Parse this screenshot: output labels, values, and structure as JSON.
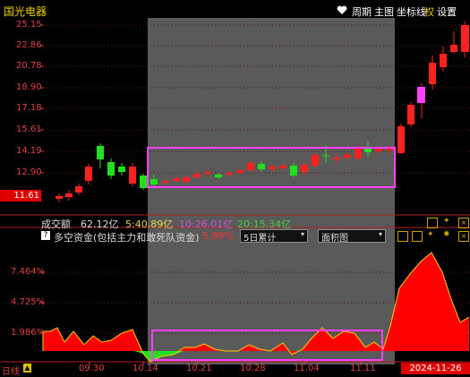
{
  "stock": {
    "name": "国光电器",
    "last_price": "11.61"
  },
  "toolbar": {
    "period": "周期",
    "main": "主图",
    "indicator": "坐标线",
    "quan": "权",
    "settings": "设置"
  },
  "price_axis": [
    "25.15",
    "22.86",
    "20.78",
    "18.90",
    "17.18",
    "15.61",
    "14.19",
    "12.90"
  ],
  "volume_bar": {
    "label": "成交额",
    "value": "62.12亿",
    "ma5": "5:40.89亿",
    "ma10": "10:26.01亿",
    "ma20": "20:15.34亿",
    "colors": {
      "ma5": "#e8d24a",
      "ma10": "#d050d0",
      "ma20": "#40d040"
    }
  },
  "indicator": {
    "name": "多空资金(包括主力和敢死队资金)",
    "value": "5.89%",
    "period_select": "5日累计",
    "chart_type_select": "面积图",
    "axis": [
      "7.464%",
      "4.725%",
      "1.986%"
    ]
  },
  "date_axis": {
    "period_label": "日线",
    "dates": [
      "09.30",
      "10.14",
      "10.21",
      "10.28",
      "11.04",
      "11.11"
    ],
    "current_date": "2024-11-26"
  },
  "colors": {
    "up": "#ff2020",
    "down": "#20e020",
    "highlight": "#ff40ff",
    "shade": "#5a5a5a"
  }
}
